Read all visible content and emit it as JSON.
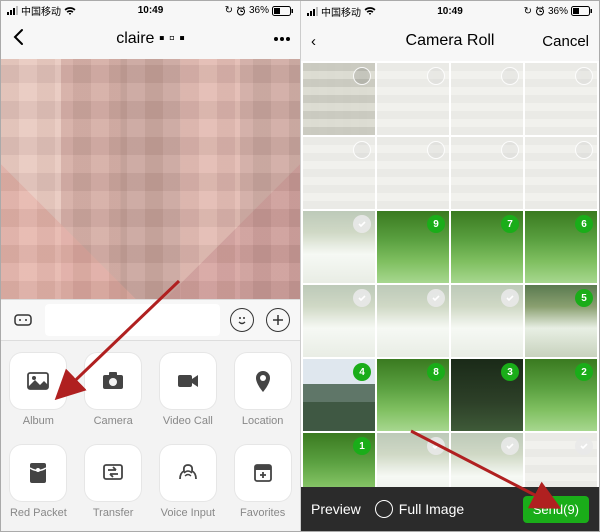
{
  "statusbar": {
    "carrier": "中国移动",
    "time": "10:49",
    "alarm": "⏰",
    "battery_pct": "36%"
  },
  "left": {
    "chat_title": "claire ▪ ▫ ▪",
    "input_placeholder": "",
    "attachments": [
      {
        "icon": "album",
        "label": "Album"
      },
      {
        "icon": "camera",
        "label": "Camera"
      },
      {
        "icon": "videocall",
        "label": "Video Call"
      },
      {
        "icon": "location",
        "label": "Location"
      },
      {
        "icon": "redpacket",
        "label": "Red Packet"
      },
      {
        "icon": "transfer",
        "label": "Transfer"
      },
      {
        "icon": "voiceinput",
        "label": "Voice Input"
      },
      {
        "icon": "favorites",
        "label": "Favorites"
      }
    ]
  },
  "right": {
    "back_label": "‹",
    "title": "Camera Roll",
    "cancel_label": "Cancel",
    "bottom": {
      "preview": "Preview",
      "full_image": "Full Image",
      "send_label": "Send(9)"
    },
    "thumbs": [
      {
        "kind": "pix",
        "sel": null,
        "dim": false
      },
      {
        "kind": "pix",
        "sel": null,
        "dim": true
      },
      {
        "kind": "pix",
        "sel": null,
        "dim": true
      },
      {
        "kind": "pix",
        "sel": null,
        "dim": true
      },
      {
        "kind": "pix",
        "sel": null,
        "dim": true
      },
      {
        "kind": "pix",
        "sel": null,
        "dim": true
      },
      {
        "kind": "pix",
        "sel": null,
        "dim": true
      },
      {
        "kind": "pix",
        "sel": null,
        "dim": true
      },
      {
        "kind": "water",
        "sel": "check",
        "dim": true
      },
      {
        "kind": "green",
        "sel": "9",
        "dim": false
      },
      {
        "kind": "green",
        "sel": "7",
        "dim": false
      },
      {
        "kind": "green",
        "sel": "6",
        "dim": false
      },
      {
        "kind": "water",
        "sel": "check",
        "dim": true
      },
      {
        "kind": "water",
        "sel": "check",
        "dim": true
      },
      {
        "kind": "water",
        "sel": "check",
        "dim": true
      },
      {
        "kind": "water",
        "sel": "5",
        "dim": false
      },
      {
        "kind": "mount",
        "sel": "4",
        "dim": false
      },
      {
        "kind": "green",
        "sel": "8",
        "dim": false
      },
      {
        "kind": "dark",
        "sel": "3",
        "dim": false
      },
      {
        "kind": "green",
        "sel": "2",
        "dim": false
      },
      {
        "kind": "green",
        "sel": "1",
        "dim": false
      },
      {
        "kind": "water",
        "sel": "check",
        "dim": true
      },
      {
        "kind": "water",
        "sel": "check",
        "dim": true
      },
      {
        "kind": "pix",
        "sel": "check",
        "dim": true
      }
    ]
  }
}
